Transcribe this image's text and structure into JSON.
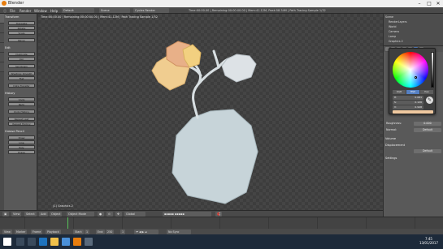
{
  "window": {
    "title": "Blender"
  },
  "menubar": {
    "items": [
      "File",
      "Render",
      "Window",
      "Help"
    ],
    "layout": "Default",
    "scene": "Scene",
    "engine": "Cycles Render",
    "stats": "Time:00:00.00 | Remaining:00:00:00.00 | Mem:41.12M, Peak:58.34M | Path Tracing Sample 1/32"
  },
  "toolshelf": {
    "panels": [
      {
        "title": "Transform",
        "buttons": [
          "Translate",
          "Rotate",
          "Scale",
          "Mirror"
        ]
      },
      {
        "title": "Edit",
        "buttons": [
          "Duplicate",
          "Join",
          "Set Origin",
          "Shading: Smooth",
          "Flat",
          "Data Transfer"
        ]
      },
      {
        "title": "History",
        "buttons": [
          "Undo",
          "Redo",
          "Undo History",
          "Repeat Last",
          "Repeat History"
        ]
      },
      {
        "title": "Grease Pencil",
        "buttons": [
          "Draw",
          "Line",
          "Poly",
          "Erase"
        ]
      }
    ]
  },
  "viewport": {
    "info": "Time:00:00.00 | Remaining:00:00:00.00 | Mem:41.12M | Path Tracing Sample 1/32",
    "object": "(1) Graphics 2"
  },
  "viewport_header": {
    "items": [
      "View",
      "Select",
      "Add",
      "Object",
      "Object Mode",
      "Global"
    ]
  },
  "timeline": {
    "items": [
      "View",
      "Marker",
      "Frame",
      "Playback",
      "Start:",
      "1",
      "End:",
      "250",
      "No Sync"
    ],
    "current_frame": "1"
  },
  "outliner": {
    "items": [
      "Scene",
      "RenderLayers",
      "World",
      "Camera",
      "Lamp",
      "Graphics 2"
    ]
  },
  "properties": {
    "rows": [
      {
        "label": "Roughness:",
        "value": "0.000"
      },
      {
        "label": "Normal:",
        "value": "Default"
      }
    ],
    "sections": [
      "Volume",
      "Displacement",
      "Settings"
    ],
    "displacement_value": "Default"
  },
  "color_picker": {
    "tabs": [
      "RGB",
      "HSV",
      "Hex"
    ],
    "fields": [
      {
        "label": "H:",
        "value": "0.081"
      },
      {
        "label": "S:",
        "value": "0.126"
      },
      {
        "label": "V:",
        "value": "0.948"
      }
    ],
    "swatch_color": "#f0c9a0"
  },
  "taskbar": {
    "time": "7:45",
    "date": "13/01/2017"
  },
  "colors": {
    "accent": "#5680c2",
    "frame_cursor": "#58c45a",
    "blender_logo": "#e87d0d"
  }
}
